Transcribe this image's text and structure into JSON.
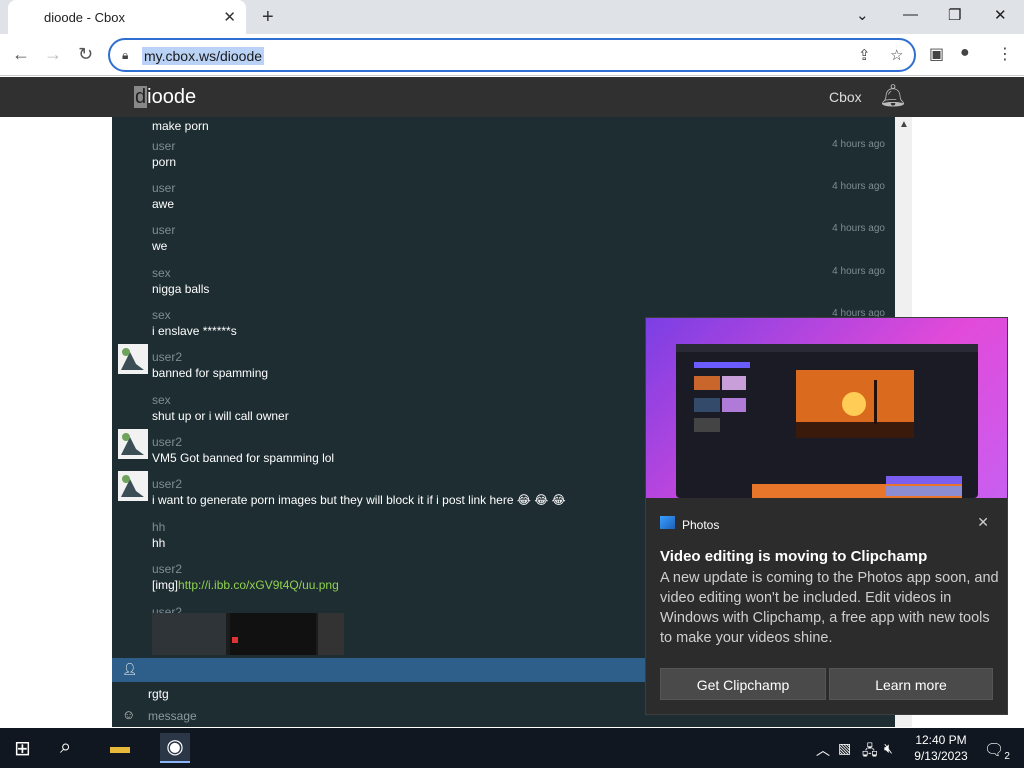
{
  "browser": {
    "tab_title": "dioode - Cbox",
    "url": "my.cbox.ws/dioode"
  },
  "site": {
    "title_cursor_char": "d",
    "title_rest": "ioode",
    "nav_link": "Cbox"
  },
  "chat": {
    "messages": [
      {
        "name": "",
        "text": "make porn",
        "time": "",
        "avatar": false
      },
      {
        "name": "user",
        "text": "porn",
        "time": "4 hours ago",
        "avatar": false
      },
      {
        "name": "user",
        "text": "awe",
        "time": "4 hours ago",
        "avatar": false
      },
      {
        "name": "user",
        "text": "we",
        "time": "4 hours ago",
        "avatar": false
      },
      {
        "name": "sex",
        "text": "nigga balls",
        "time": "4 hours ago",
        "avatar": false
      },
      {
        "name": "sex",
        "text": "i enslave ******s",
        "time": "4 hours ago",
        "avatar": false
      },
      {
        "name": "user2",
        "text": "banned for spamming",
        "time": "",
        "avatar": true
      },
      {
        "name": "sex",
        "text": "shut up or i will call owner",
        "time": "",
        "avatar": false
      },
      {
        "name": "user2",
        "text": "VM5 Got banned for spamming lol",
        "time": "",
        "avatar": true
      },
      {
        "name": "user2",
        "text": "i want to generate porn images but they will block it if i post link here 😂 😂 😂",
        "time": "",
        "avatar": true
      },
      {
        "name": "hh",
        "text": "hh",
        "time": "",
        "avatar": false
      },
      {
        "name": "user2",
        "text_prefix": "[img]",
        "link": "http://i.ibb.co/xGV9t4Q/uu.png",
        "time": "",
        "avatar": false
      },
      {
        "name": "user2",
        "text": "",
        "time": "",
        "avatar": false,
        "image": true
      }
    ]
  },
  "composer": {
    "name_value": "rgtg",
    "message_placeholder": "message"
  },
  "toast": {
    "app": "Photos",
    "title": "Video editing is moving to Clipchamp",
    "body": "A new update is coming to the Photos app soon, and video editing won't be included. Edit videos in Windows with Clipchamp, a free app with new tools to make your videos shine.",
    "primary_button": "Get Clipchamp",
    "secondary_button": "Learn more"
  },
  "taskbar": {
    "time": "12:40 PM",
    "date": "9/13/2023",
    "notification_count": "2"
  }
}
